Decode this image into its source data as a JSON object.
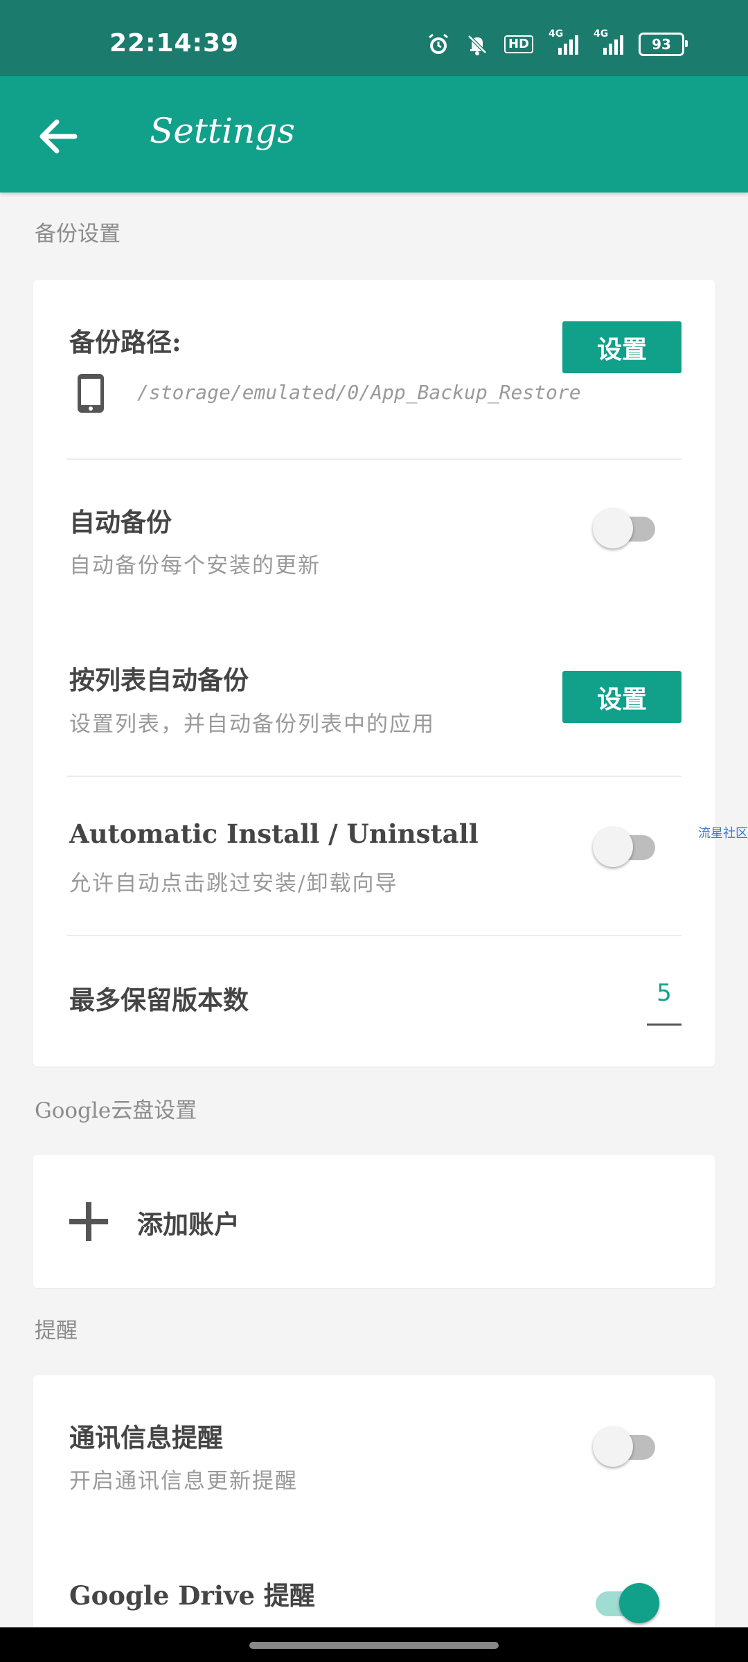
{
  "status_bar": {
    "time": "22:14:39",
    "icons": [
      "alarm-icon",
      "bell-muted-icon",
      "hd-icon",
      "signal-4g-icon",
      "signal-4g-icon",
      "battery-icon"
    ],
    "hd_label": "HD",
    "network_label_1": "4G",
    "network_label_2": "4G",
    "battery": "93"
  },
  "app_bar": {
    "title": "Settings"
  },
  "sections": {
    "backup": {
      "title": "备份设置",
      "path_label": "备份路径:",
      "path_button": "设置",
      "path_value": "/storage/emulated/0/App_Backup_Restore",
      "auto_backup_title": "自动备份",
      "auto_backup_sub": "自动备份每个安装的更新",
      "auto_backup_on": false,
      "list_backup_title": "按列表自动备份",
      "list_backup_sub": "设置列表，并自动备份列表中的应用",
      "list_backup_button": "设置",
      "auto_install_title": "Automatic Install / Uninstall",
      "auto_install_sub": "允许自动点击跳过安装/卸载向导",
      "auto_install_on": false,
      "max_versions_title": "最多保留版本数",
      "max_versions_value": "5"
    },
    "google": {
      "title": "Google云盘设置",
      "add_account": "添加账户"
    },
    "reminders": {
      "title": "提醒",
      "contacts_title": "通讯信息提醒",
      "contacts_sub": "开启通讯信息更新提醒",
      "contacts_on": false,
      "drive_title": "Google Drive 提醒",
      "drive_on": true
    }
  },
  "side_watermark": "流星社区",
  "colors": {
    "accent": "#11a08a",
    "status_bar": "#1b7b6d"
  }
}
